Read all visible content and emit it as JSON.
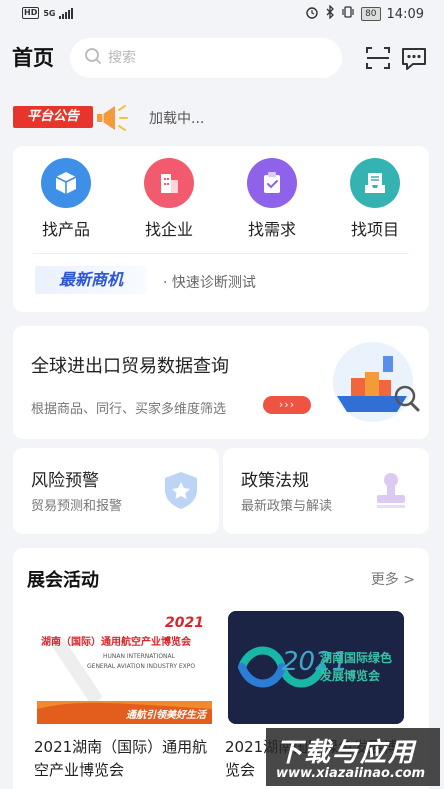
{
  "status_bar": {
    "network": "HD",
    "network_type": "5G",
    "time": "14:09",
    "battery": "80"
  },
  "header": {
    "title": "首页",
    "search_placeholder": "搜索"
  },
  "notice": {
    "badge": "平台公告",
    "text": "加载中..."
  },
  "quick_nav": {
    "items": [
      {
        "label": "找产品",
        "icon": "package-icon",
        "color": "#3d8fe8"
      },
      {
        "label": "找企业",
        "icon": "building-icon",
        "color": "#f25a6e"
      },
      {
        "label": "找需求",
        "icon": "clipboard-check-icon",
        "color": "#8f62ea"
      },
      {
        "label": "找项目",
        "icon": "inbox-tray-icon",
        "color": "#35b3b3"
      }
    ],
    "business_badge": "最新商机",
    "business_text": "· 快速诊断测试"
  },
  "trade": {
    "title": "全球进出口贸易数据查询",
    "subtitle": "根据商品、同行、买家多维度筛选",
    "arrow_label": "›››"
  },
  "risk": {
    "title": "风险预警",
    "subtitle": "贸易预测和报警",
    "icon": "shield-star-icon"
  },
  "policy": {
    "title": "政策法规",
    "subtitle": "最新政策与解读",
    "icon": "stamp-icon"
  },
  "expo": {
    "title": "展会活动",
    "more_label": "更多 >",
    "items": [
      {
        "name": "2021湖南（国际）通用航空产业博览会",
        "poster_year": "2021",
        "poster_title": "湖南（国际）通用航空产业博览会",
        "poster_en_1": "HUNAN INTERNATIONAL",
        "poster_en_2": "GENERAL AVIATION INDUSTRY EXPO",
        "poster_slogan": "通航引领美好生活"
      },
      {
        "name": "2021湖南国际绿色发展博览会",
        "poster_year": "2021",
        "poster_title_1": "湖南国际绿色",
        "poster_title_2": "发展博览会"
      }
    ]
  },
  "watermark": {
    "line1": "下载与应用",
    "line2": "www.xiazaiinao.com"
  }
}
